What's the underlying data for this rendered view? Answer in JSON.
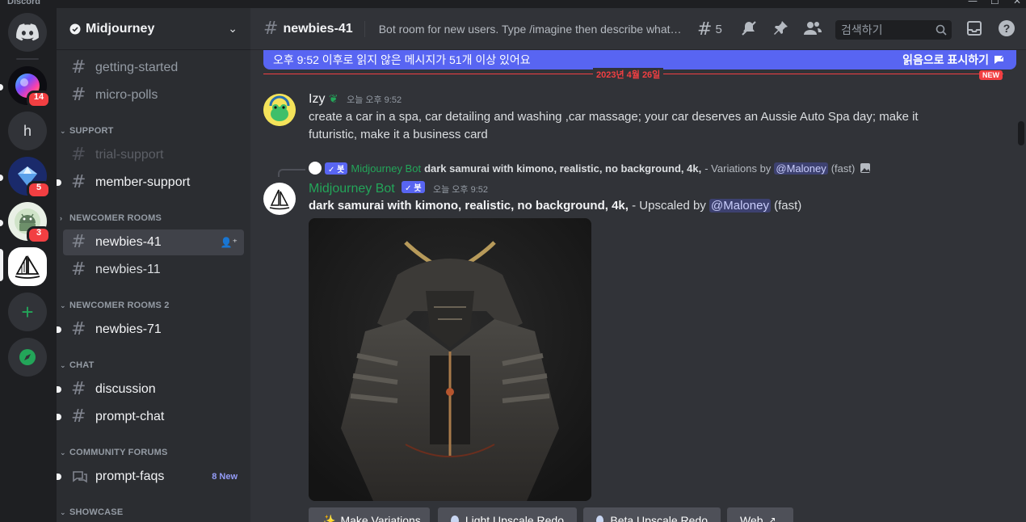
{
  "window": {
    "title": "Discord",
    "controls": [
      "—",
      "☐",
      "✕"
    ]
  },
  "guilds": [
    {
      "name": "Home",
      "icon": "discord-logo-icon",
      "badge": ""
    },
    {
      "name": "Rainbow server",
      "icon": "rainbow-circle-icon",
      "badge": "14"
    },
    {
      "name": "h",
      "icon": "letter-h",
      "badge": ""
    },
    {
      "name": "Diamond server",
      "icon": "diamond-icon",
      "badge": "5"
    },
    {
      "name": "Android server",
      "icon": "android-icon",
      "badge": "3"
    },
    {
      "name": "Midjourney",
      "icon": "sailboat-icon",
      "badge": ""
    },
    {
      "name": "Add a Server",
      "icon": "plus-icon",
      "badge": ""
    },
    {
      "name": "Explore",
      "icon": "compass-icon",
      "badge": ""
    }
  ],
  "server": {
    "name": "Midjourney"
  },
  "sidebar": {
    "channels": [
      {
        "label": "getting-started",
        "state": "normal"
      },
      {
        "label": "micro-polls",
        "state": "normal"
      },
      {
        "label": "trial-support",
        "state": "muted"
      },
      {
        "label": "member-support",
        "state": "unread"
      },
      {
        "label": "newbies-41",
        "state": "active"
      },
      {
        "label": "newbies-11",
        "state": "normal"
      },
      {
        "label": "newbies-71",
        "state": "unread"
      },
      {
        "label": "discussion",
        "state": "unread"
      },
      {
        "label": "prompt-chat",
        "state": "unread"
      },
      {
        "label": "prompt-faqs",
        "state": "unread",
        "extra": "8 New"
      }
    ],
    "categories": [
      "SUPPORT",
      "NEWCOMER ROOMS",
      "NEWCOMER ROOMS 2",
      "CHAT",
      "COMMUNITY FORUMS",
      "SHOWCASE"
    ]
  },
  "header": {
    "channel": "newbies-41",
    "topic": "Bot room for new users. Type /imagine then describe what yo...",
    "threads_count": "5",
    "search_placeholder": "검색하기"
  },
  "new_messages_bar": {
    "text": "오후 9:52 이후로 읽지 않은 메시지가 51개 이상 있어요",
    "mark_read": "읽음으로 표시하기"
  },
  "divider": {
    "date": "2023년 4월 26일",
    "tag": "NEW"
  },
  "messages": [
    {
      "author": "Izy",
      "timestamp": "오늘 오후 9:52",
      "text": "create a car in a spa, car detailing and washing ,car massage; your car deserves an Aussie Auto Spa day; make it futuristic, make it a business card"
    },
    {
      "reply": {
        "author": "Midjourney Bot",
        "badge": "✓ 봇",
        "prompt": "dark samurai with kimono, realistic, no background, 4k,",
        "suffix": "- Variations by",
        "mention": "@Maloney",
        "speed": "(fast)"
      },
      "author": "Midjourney Bot",
      "badge": "✓ 봇",
      "timestamp": "오늘 오후 9:52",
      "prompt": "dark samurai with kimono, realistic, no background, 4k,",
      "suffix": "- Upscaled by",
      "mention": "@Maloney",
      "speed": "(fast)"
    }
  ],
  "actions": [
    "Make Variations",
    "Light Upscale Redo",
    "Beta Upscale Redo",
    "Web"
  ],
  "colors": {
    "accent": "#5865f2",
    "danger": "#f23f42",
    "bot_name": "#23a559",
    "bg_main": "#313338",
    "bg_sidebar": "#2b2d31",
    "bg_rail": "#1e1f22"
  }
}
